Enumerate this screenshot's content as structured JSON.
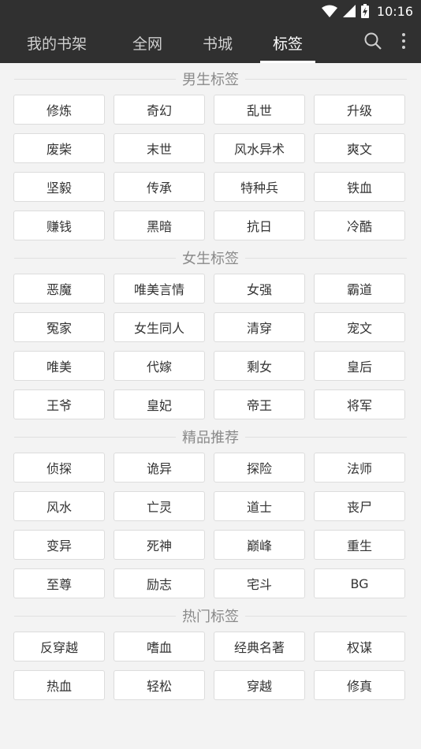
{
  "status_bar": {
    "time": "10:16"
  },
  "tabs": [
    {
      "label": "我的书架",
      "active": false
    },
    {
      "label": "全网",
      "active": false
    },
    {
      "label": "书城",
      "active": false
    },
    {
      "label": "标签",
      "active": true
    }
  ],
  "icons": {
    "search": "search-icon",
    "more": "more-vert-icon"
  },
  "sections": [
    {
      "title": "男生标签",
      "tags": [
        "修炼",
        "奇幻",
        "乱世",
        "升级",
        "废柴",
        "末世",
        "风水异术",
        "爽文",
        "坚毅",
        "传承",
        "特种兵",
        "铁血",
        "赚钱",
        "黑暗",
        "抗日",
        "冷酷"
      ]
    },
    {
      "title": "女生标签",
      "tags": [
        "恶魔",
        "唯美言情",
        "女强",
        "霸道",
        "冤家",
        "女生同人",
        "清穿",
        "宠文",
        "唯美",
        "代嫁",
        "剩女",
        "皇后",
        "王爷",
        "皇妃",
        "帝王",
        "将军"
      ]
    },
    {
      "title": "精品推荐",
      "tags": [
        "侦探",
        "诡异",
        "探险",
        "法师",
        "风水",
        "亡灵",
        "道士",
        "丧尸",
        "变异",
        "死神",
        "巅峰",
        "重生",
        "至尊",
        "励志",
        "宅斗",
        "BG"
      ]
    },
    {
      "title": "热门标签",
      "tags": [
        "反穿越",
        "嗜血",
        "经典名著",
        "权谋",
        "热血",
        "轻松",
        "穿越",
        "修真"
      ]
    }
  ]
}
